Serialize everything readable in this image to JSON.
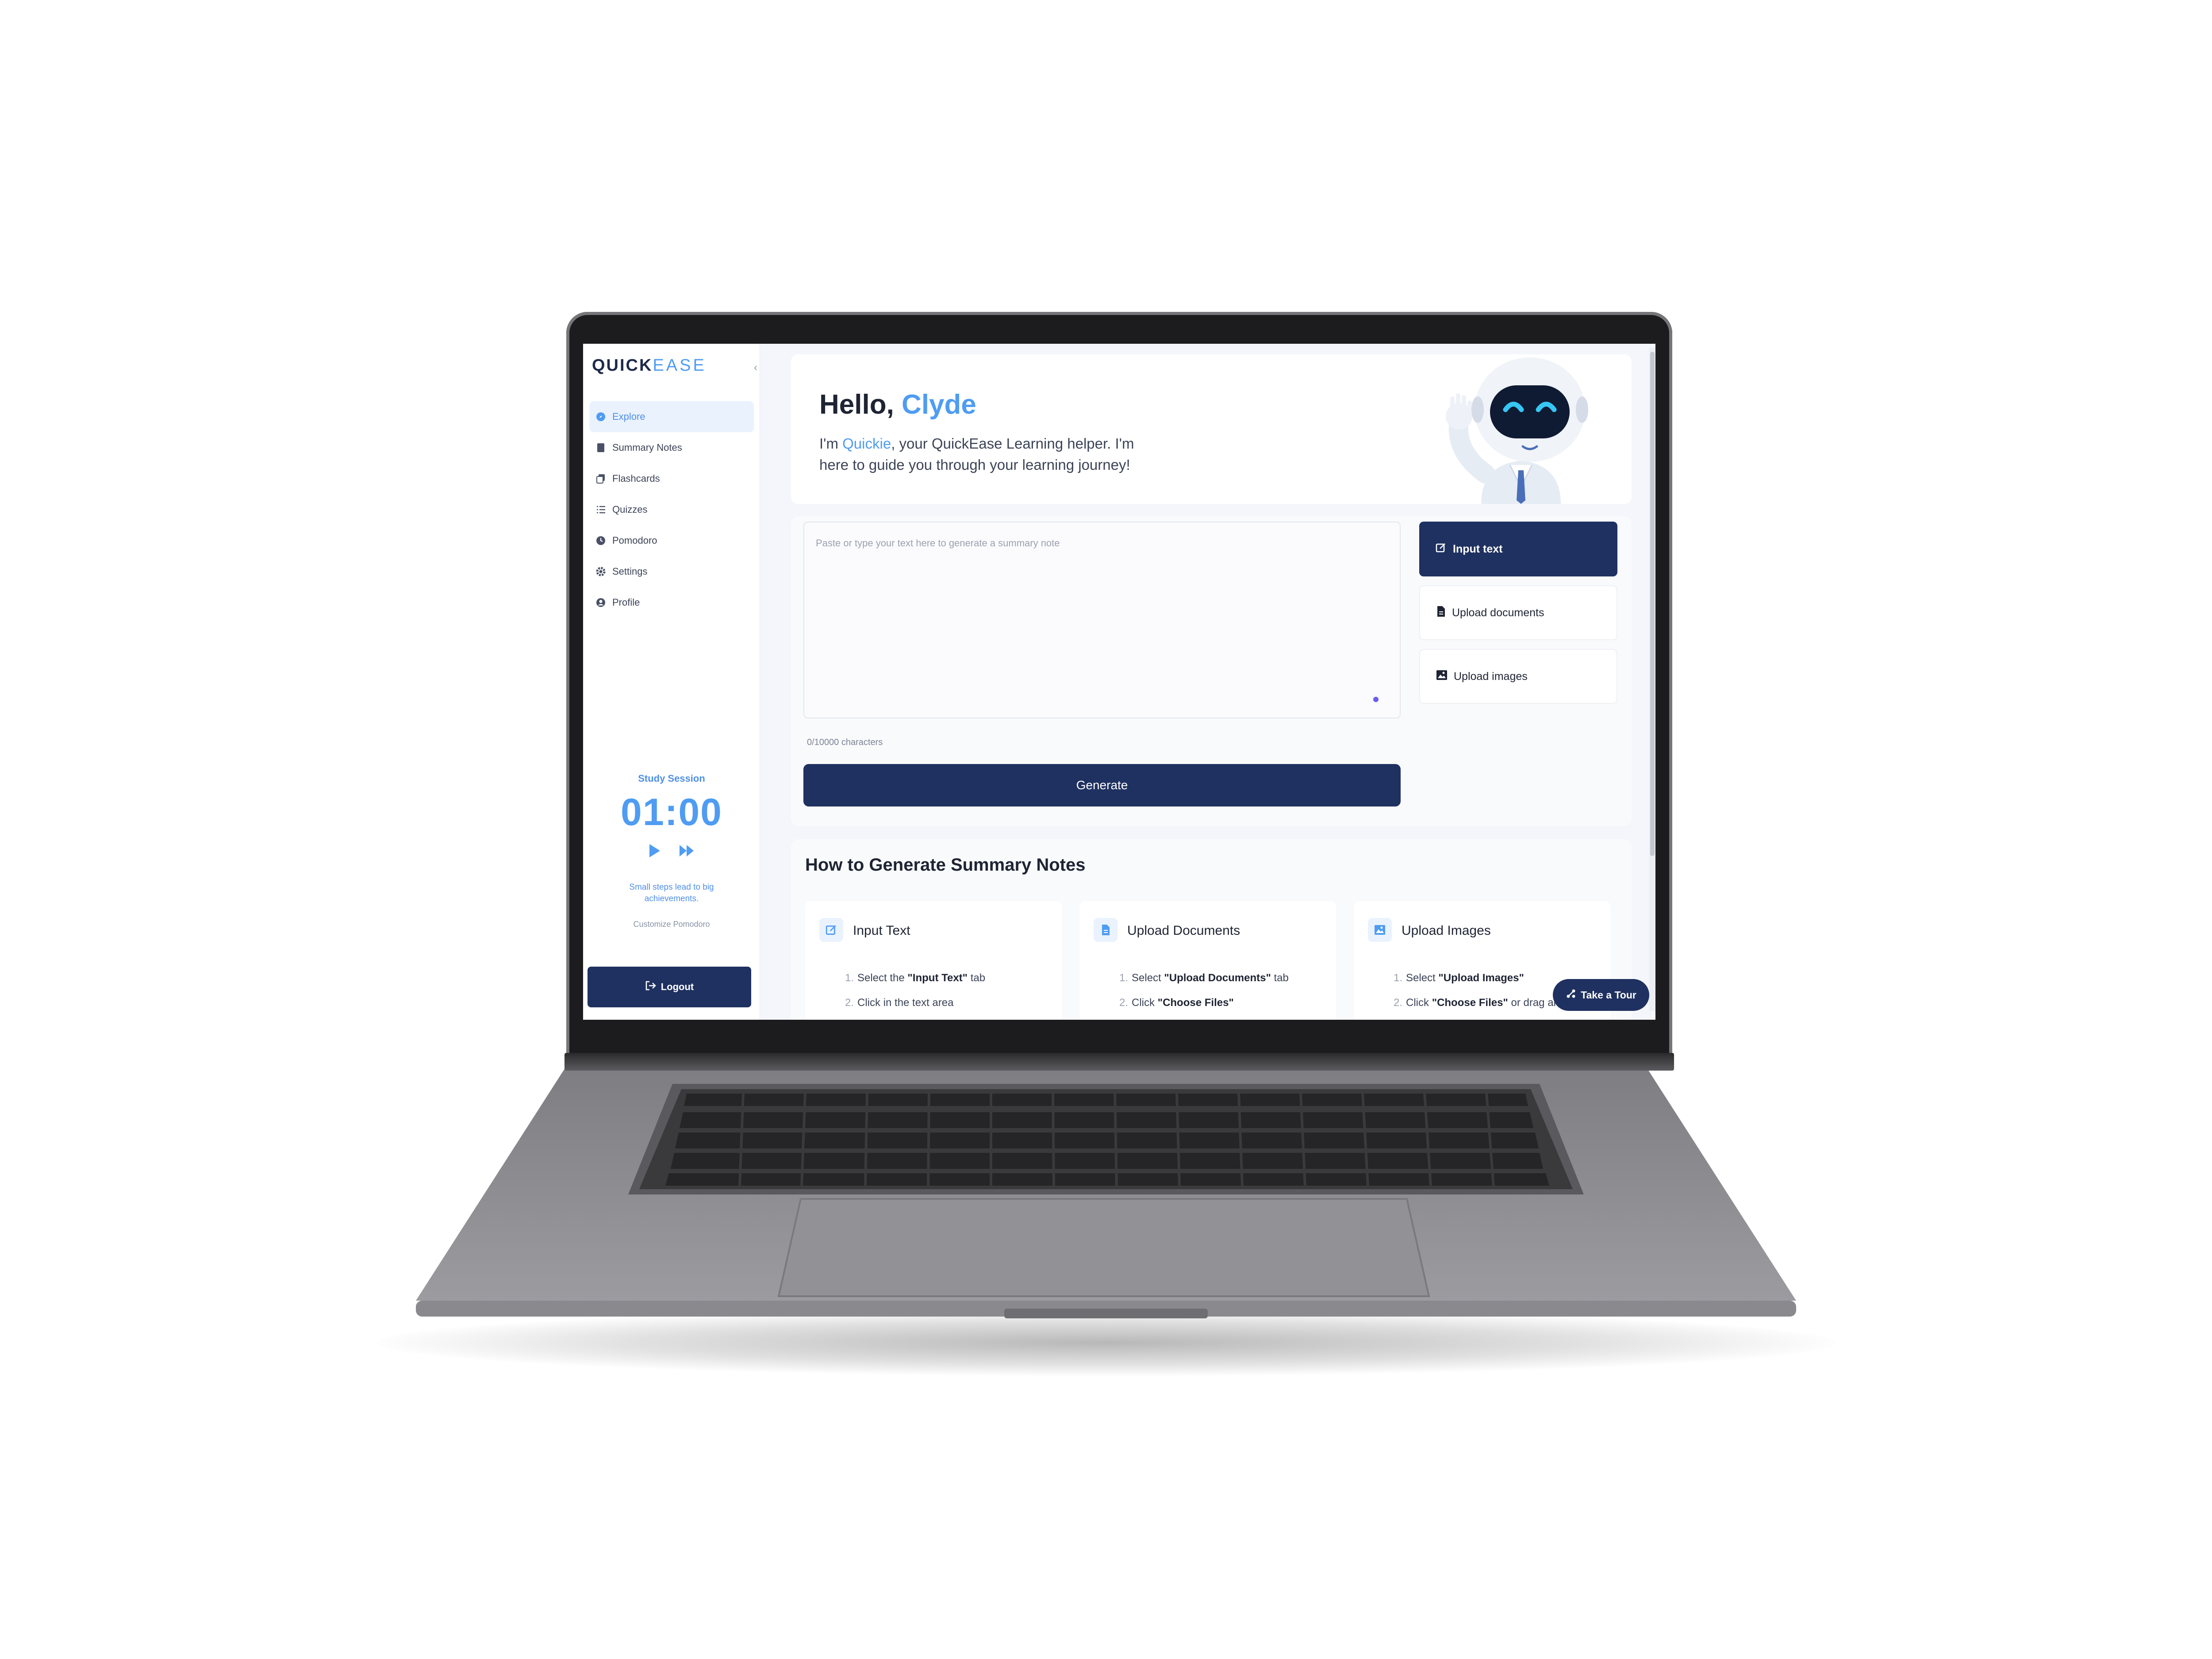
{
  "app": {
    "logo_main": "QUICK",
    "logo_accent": "EASE"
  },
  "sidebar": {
    "items": [
      {
        "label": "Explore",
        "icon": "compass-icon"
      },
      {
        "label": "Summary Notes",
        "icon": "note-icon"
      },
      {
        "label": "Flashcards",
        "icon": "cards-icon"
      },
      {
        "label": "Quizzes",
        "icon": "list-icon"
      },
      {
        "label": "Pomodoro",
        "icon": "clock-icon"
      },
      {
        "label": "Settings",
        "icon": "gear-icon"
      },
      {
        "label": "Profile",
        "icon": "user-icon"
      }
    ],
    "active_index": 0,
    "study": {
      "title": "Study Session",
      "time": "01:00",
      "motto": "Small steps lead to big achievements.",
      "customize": "Customize Pomodoro"
    },
    "logout_label": "Logout"
  },
  "hero": {
    "greeting": "Hello,",
    "name": "Clyde",
    "intro_prefix": "I'm",
    "helper_name": "Quickie",
    "intro_suffix": ", your QuickEase Learning helper. I'm here to guide you through your learning journey!"
  },
  "editor": {
    "placeholder": "Paste or type your text here to generate a summary note",
    "counter": "0/10000 characters",
    "generate_label": "Generate"
  },
  "tabs": [
    {
      "label": "Input text",
      "icon": "edit-icon",
      "active": true
    },
    {
      "label": "Upload documents",
      "icon": "document-icon",
      "active": false
    },
    {
      "label": "Upload images",
      "icon": "image-icon",
      "active": false
    }
  ],
  "howto": {
    "title": "How to Generate Summary Notes",
    "cards": [
      {
        "title": "Input Text",
        "icon": "edit-icon",
        "steps": [
          {
            "n": "1.",
            "pre": "Select the ",
            "bold": "\"Input Text\"",
            "post": " tab"
          },
          {
            "n": "2.",
            "pre": "Click in the text area",
            "bold": "",
            "post": ""
          }
        ]
      },
      {
        "title": "Upload Documents",
        "icon": "document-icon",
        "steps": [
          {
            "n": "1.",
            "pre": "Select ",
            "bold": "\"Upload Documents\"",
            "post": " tab"
          },
          {
            "n": "2.",
            "pre": "Click ",
            "bold": "\"Choose Files\"",
            "post": ""
          }
        ]
      },
      {
        "title": "Upload Images",
        "icon": "image-icon",
        "steps": [
          {
            "n": "1.",
            "pre": "Select ",
            "bold": "\"Upload Images\"",
            "post": ""
          },
          {
            "n": "2.",
            "pre": "Click ",
            "bold": "\"Choose Files\"",
            "post": " or drag and"
          }
        ]
      }
    ]
  },
  "tour_label": "Take a Tour",
  "colors": {
    "accent": "#4f9cf2",
    "navy": "#1f3160"
  }
}
